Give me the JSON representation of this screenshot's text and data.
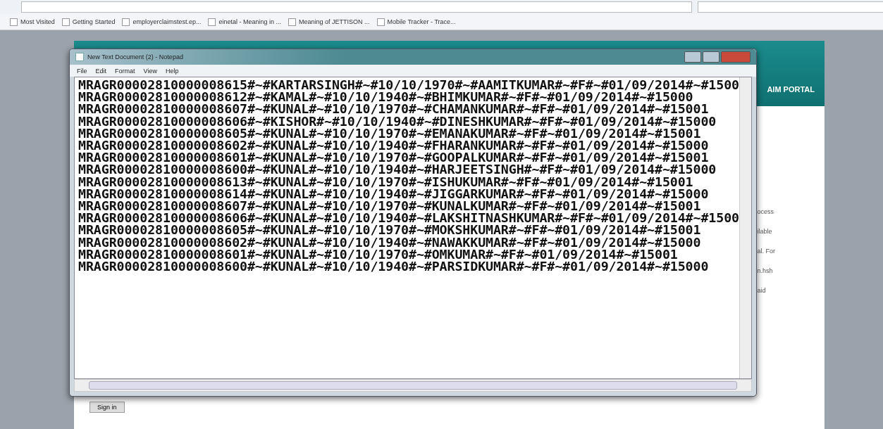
{
  "bookmarks": [
    "Most Visited",
    "Getting Started",
    "employerclaimstest.ep...",
    "einetal - Meaning in ...",
    "Meaning of JETTISON ...",
    "Mobile Tracker - Trace..."
  ],
  "website": {
    "header_text": "AIM PORTAL",
    "side_fragments": [
      "ocess",
      "ilable",
      "al. For",
      "n.hsh",
      "aid"
    ],
    "sign_in": "Sign in"
  },
  "notepad": {
    "title": "New Text Document (2) - Notepad",
    "menu": [
      "File",
      "Edit",
      "Format",
      "View",
      "Help"
    ],
    "lines": [
      "MRAGR00002810000008615#~#KARTARSINGH#~#10/10/1970#~#AAMITKUMAR#~#F#~#01/09/2014#~#1500",
      "MRAGR00002810000008612#~#KAMAL#~#10/10/1940#~#BHIMKUMAR#~#F#~#01/09/2014#~#15000",
      "MRAGR00002810000008607#~#KUNAL#~#10/10/1970#~#CHAMANKUMAR#~#F#~#01/09/2014#~#15001",
      "MRAGR00002810000008606#~#KISHOR#~#10/10/1940#~#DINESHKUMAR#~#F#~#01/09/2014#~#15000",
      "MRAGR00002810000008605#~#KUNAL#~#10/10/1970#~#EMANAKUMAR#~#F#~#01/09/2014#~#15001",
      "MRAGR00002810000008602#~#KUNAL#~#10/10/1940#~#FHARANKUMAR#~#F#~#01/09/2014#~#15000",
      "MRAGR00002810000008601#~#KUNAL#~#10/10/1970#~#GOOPALKUMAR#~#F#~#01/09/2014#~#15001",
      "MRAGR00002810000008600#~#KUNAL#~#10/10/1940#~#HARJEETSINGH#~#F#~#01/09/2014#~#15000",
      "MRAGR00002810000008613#~#KUNAL#~#10/10/1970#~#ISHUKUMAR#~#F#~#01/09/2014#~#15001",
      "MRAGR00002810000008614#~#KUNAL#~#10/10/1940#~#JIGGARKUMAR#~#F#~#01/09/2014#~#15000",
      "MRAGR00002810000008607#~#KUNAL#~#10/10/1970#~#KUNALKUMAR#~#F#~#01/09/2014#~#15001",
      "MRAGR00002810000008606#~#KUNAL#~#10/10/1940#~#LAKSHITNASHKUMAR#~#F#~#01/09/2014#~#1500",
      "MRAGR00002810000008605#~#KUNAL#~#10/10/1970#~#MOKSHKUMAR#~#F#~#01/09/2014#~#15001",
      "MRAGR00002810000008602#~#KUNAL#~#10/10/1940#~#NAWAKKUMAR#~#F#~#01/09/2014#~#15000",
      "MRAGR00002810000008601#~#KUNAL#~#10/10/1970#~#OMKUMAR#~#F#~#01/09/2014#~#15001",
      "MRAGR00002810000008600#~#KUNAL#~#10/10/1940#~#PARSIDKUMAR#~#F#~#01/09/2014#~#15000"
    ]
  }
}
